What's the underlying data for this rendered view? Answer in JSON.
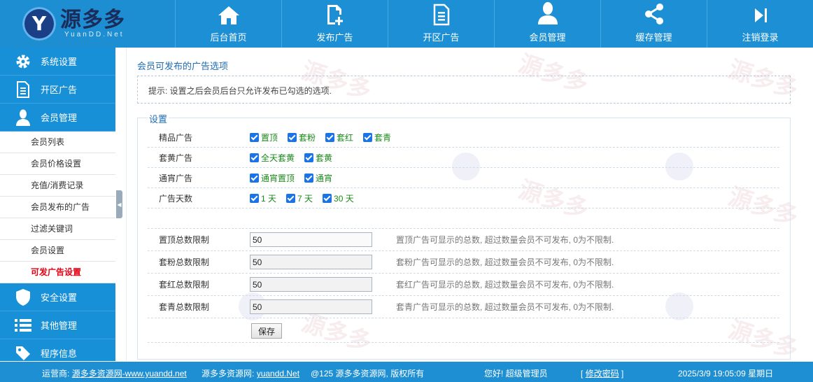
{
  "brand": {
    "name_cn": "源多多",
    "name_en": "YuanDD.Net"
  },
  "topnav": [
    {
      "label": "后台首页",
      "icon": "home-icon"
    },
    {
      "label": "发布广告",
      "icon": "document-plus-icon"
    },
    {
      "label": "开区广告",
      "icon": "document-icon"
    },
    {
      "label": "会员管理",
      "icon": "user-icon"
    },
    {
      "label": "缓存管理",
      "icon": "share-icon"
    },
    {
      "label": "注销登录",
      "icon": "skip-forward-icon"
    }
  ],
  "sidebar": {
    "groups_top": [
      {
        "label": "系统设置",
        "icon": "gear-icon"
      },
      {
        "label": "开区广告",
        "icon": "document-icon"
      },
      {
        "label": "会员管理",
        "icon": "user-icon"
      }
    ],
    "sub_items": [
      {
        "label": "会员列表"
      },
      {
        "label": "会员价格设置"
      },
      {
        "label": "充值/消费记录"
      },
      {
        "label": "会员发布的广告"
      },
      {
        "label": "过滤关键词"
      },
      {
        "label": "会员设置"
      },
      {
        "label": "可发广告设置",
        "active": true
      }
    ],
    "groups_bottom": [
      {
        "label": "安全设置",
        "icon": "shield-icon"
      },
      {
        "label": "其他管理",
        "icon": "list-icon"
      },
      {
        "label": "程序信息",
        "icon": "tag-icon"
      }
    ]
  },
  "main": {
    "title": "会员可发布的广告选项",
    "hint": "提示: 设置之后会员后台只允许发布已勾选的选项.",
    "legend": "设置",
    "checkbox_rows": [
      {
        "label": "精品广告",
        "options": [
          {
            "label": "置顶",
            "checked": true
          },
          {
            "label": "套粉",
            "checked": true
          },
          {
            "label": "套红",
            "checked": true
          },
          {
            "label": "套青",
            "checked": true
          }
        ]
      },
      {
        "label": "套黄广告",
        "options": [
          {
            "label": "全天套黄",
            "checked": true
          },
          {
            "label": "套黄",
            "checked": true
          }
        ]
      },
      {
        "label": "通宵广告",
        "options": [
          {
            "label": "通宵置顶",
            "checked": true
          },
          {
            "label": "通宵",
            "checked": true
          }
        ]
      },
      {
        "label": "广告天数",
        "options": [
          {
            "label": "1 天",
            "checked": true
          },
          {
            "label": "7 天",
            "checked": true
          },
          {
            "label": "30 天",
            "checked": true
          }
        ]
      }
    ],
    "limit_rows": [
      {
        "label": "置顶总数限制",
        "value": "50",
        "desc": "置顶广告可显示的总数, 超过数量会员不可发布, 0为不限制."
      },
      {
        "label": "套粉总数限制",
        "value": "50",
        "desc": "套粉广告可显示的总数, 超过数量会员不可发布, 0为不限制."
      },
      {
        "label": "套红总数限制",
        "value": "50",
        "desc": "套红广告可显示的总数, 超过数量会员不可发布, 0为不限制."
      },
      {
        "label": "套青总数限制",
        "value": "50",
        "desc": "套青广告可显示的总数, 超过数量会员不可发布, 0为不限制."
      }
    ],
    "save_label": "保存"
  },
  "footer": {
    "operator_label": "运营商:",
    "operator_link": "源多多资源网-www.yuandd.net",
    "site_label": "源多多资源网:",
    "site_link": "yuandd.Net",
    "copyright": "@125 源多多资源网, 版权所有",
    "greeting": "您好! 超级管理员",
    "change_pwd_open": "[",
    "change_pwd": "修改密码",
    "change_pwd_close": "]",
    "datetime": "2025/3/9 19:05:09 星期日"
  },
  "colors": {
    "brand_blue": "#1f8fd3",
    "active_red": "#e60012",
    "checkbox_label_green": "#1a8a1a",
    "title_blue": "#1e6cb4"
  }
}
